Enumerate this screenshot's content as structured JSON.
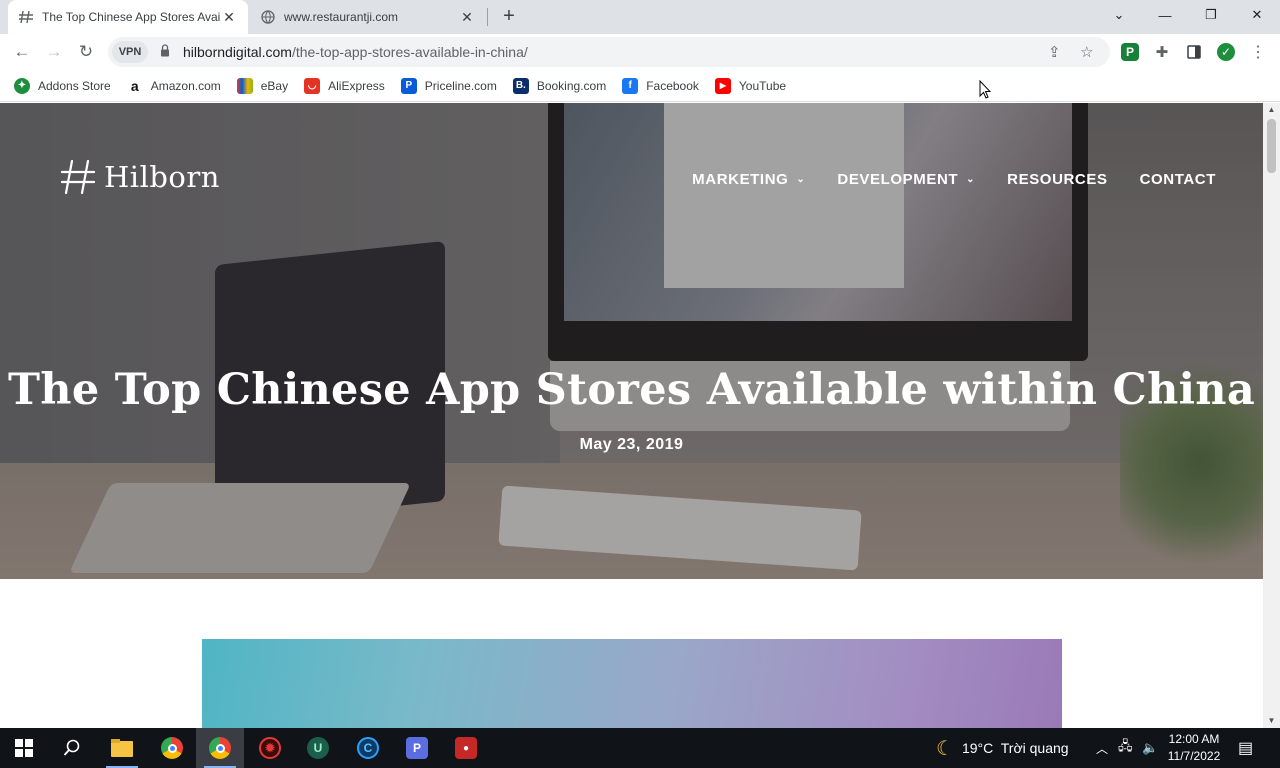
{
  "browser": {
    "tabs": [
      {
        "title": "The Top Chinese App Stores Avai",
        "active": true
      },
      {
        "title": "www.restaurantji.com",
        "active": false
      }
    ],
    "new_tab": "+",
    "address": {
      "vpn": "VPN",
      "host": "hilborndigital.com",
      "path": "/the-top-app-stores-available-in-china/"
    },
    "bookmarks": [
      {
        "label": "Addons Store",
        "icon": "addons-icon",
        "color": "#1e8e3e",
        "glyph": "✦"
      },
      {
        "label": "Amazon.com",
        "icon": "amazon-icon",
        "color": "#ffffff",
        "glyph": "a"
      },
      {
        "label": "eBay",
        "icon": "ebay-icon",
        "color": "#3a3a3a",
        "glyph": "▣"
      },
      {
        "label": "AliExpress",
        "icon": "aliexpress-icon",
        "color": "#e43225",
        "glyph": "◡"
      },
      {
        "label": "Priceline.com",
        "icon": "priceline-icon",
        "color": "#0a5bd8",
        "glyph": "P"
      },
      {
        "label": "Booking.com",
        "icon": "booking-icon",
        "color": "#0b2d6b",
        "glyph": "B."
      },
      {
        "label": "Facebook",
        "icon": "facebook-icon",
        "color": "#1877f2",
        "glyph": "f"
      },
      {
        "label": "YouTube",
        "icon": "youtube-icon",
        "color": "#ff0000",
        "glyph": "▶"
      }
    ]
  },
  "site": {
    "logo": "Hilborn",
    "nav": [
      {
        "label": "MARKETING",
        "dropdown": true
      },
      {
        "label": "DEVELOPMENT",
        "dropdown": true
      },
      {
        "label": "RESOURCES",
        "dropdown": false
      },
      {
        "label": "CONTACT",
        "dropdown": false
      }
    ],
    "title": "The Top Chinese App Stores Available within China",
    "date": "May 23, 2019"
  },
  "taskbar": {
    "weather": "19°C  Trời quang",
    "time": "12:00 AM",
    "date": "11/7/2022"
  },
  "colors": {
    "tabstrip": "#dee1e6",
    "taskbar": "#101418",
    "hero_text": "#ffffff"
  }
}
